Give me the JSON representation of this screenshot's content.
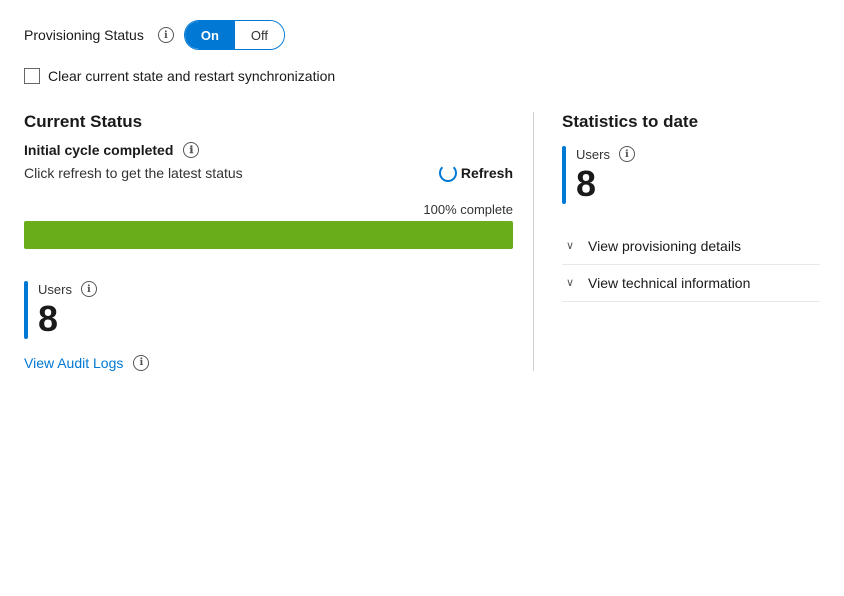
{
  "header": {
    "provisioning_status_label": "Provisioning Status",
    "toggle_on_label": "On",
    "toggle_off_label": "Off",
    "checkbox_label": "Clear current state and restart synchronization"
  },
  "current_status": {
    "title": "Current Status",
    "cycle_label": "Initial cycle completed",
    "click_refresh_text": "Click refresh to get the latest status",
    "refresh_label": "Refresh",
    "progress_label": "100% complete",
    "progress_percent": 100
  },
  "bottom_users": {
    "label": "Users",
    "count": "8",
    "audit_logs_label": "View Audit Logs"
  },
  "statistics": {
    "title": "Statistics to date",
    "users": {
      "label": "Users",
      "count": "8"
    },
    "items": [
      {
        "label": "View provisioning details"
      },
      {
        "label": "View technical information"
      }
    ]
  },
  "icons": {
    "info": "ℹ",
    "chevron_down": "∨"
  }
}
